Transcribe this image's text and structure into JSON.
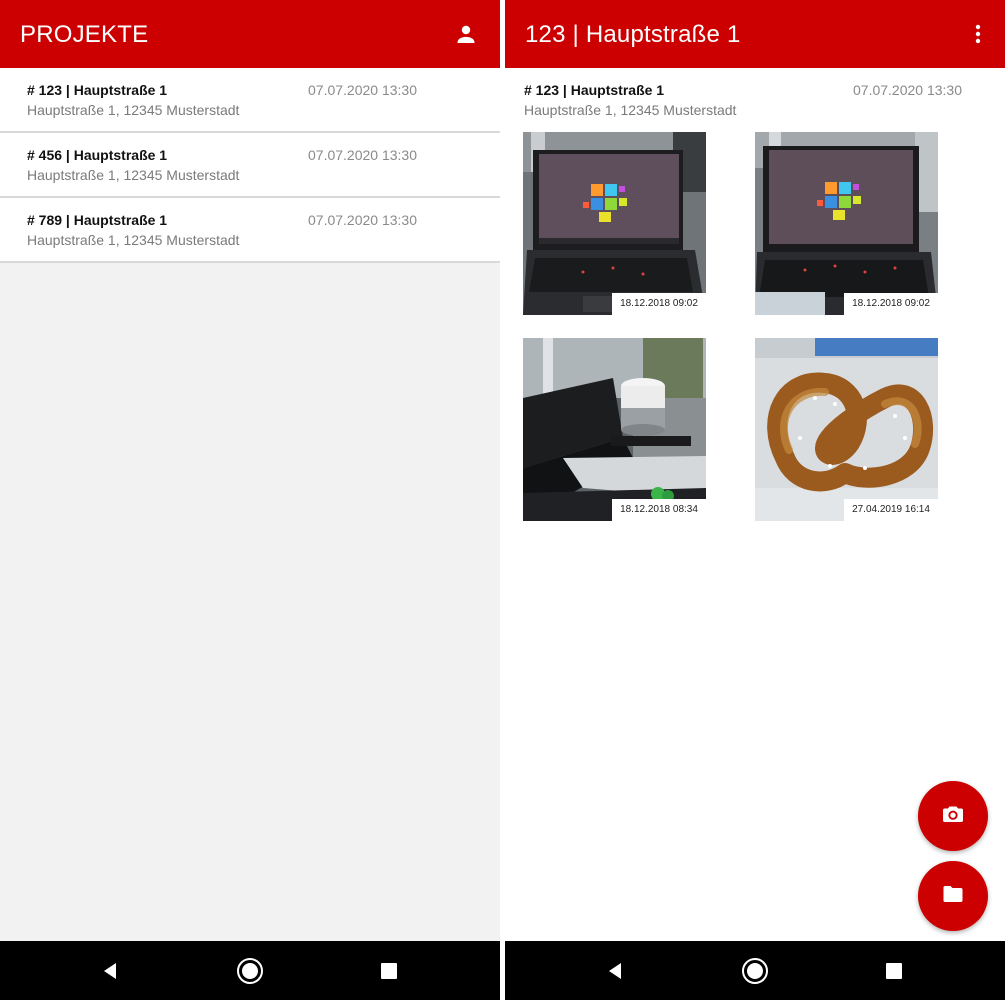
{
  "theme": {
    "primary": "#cc0000",
    "navbar": "#000000",
    "list_background": "#f2f2f2"
  },
  "left_screen": {
    "appbar": {
      "title": "PROJEKTE",
      "action_icon": "person-icon"
    },
    "projects": [
      {
        "name": "# 123 | Hauptstraße 1",
        "address": "Hauptstraße 1, 12345 Musterstadt",
        "date": "07.07.2020 13:30"
      },
      {
        "name": "# 456 | Hauptstraße 1",
        "address": "Hauptstraße 1, 12345 Musterstadt",
        "date": "07.07.2020 13:30"
      },
      {
        "name": "# 789 | Hauptstraße 1",
        "address": "Hauptstraße 1, 12345 Musterstadt",
        "date": "07.07.2020 13:30"
      }
    ]
  },
  "right_screen": {
    "appbar": {
      "title": "123 | Hauptstraße 1",
      "action_icon": "more-vert-icon"
    },
    "project": {
      "name": "# 123 | Hauptstraße 1",
      "address": "Hauptstraße 1, 12345 Musterstadt",
      "date": "07.07.2020 13:30"
    },
    "photos": [
      {
        "subject": "laptop",
        "timestamp": "18.12.2018 09:02"
      },
      {
        "subject": "laptop",
        "timestamp": "18.12.2018 09:02"
      },
      {
        "subject": "smart-speaker",
        "timestamp": "18.12.2018 08:34"
      },
      {
        "subject": "pretzel",
        "timestamp": "27.04.2019 16:14"
      }
    ],
    "fabs": [
      {
        "icon": "camera-icon"
      },
      {
        "icon": "folder-icon"
      }
    ]
  },
  "system_nav": {
    "icons": [
      "back-icon",
      "home-icon",
      "recents-icon"
    ]
  }
}
